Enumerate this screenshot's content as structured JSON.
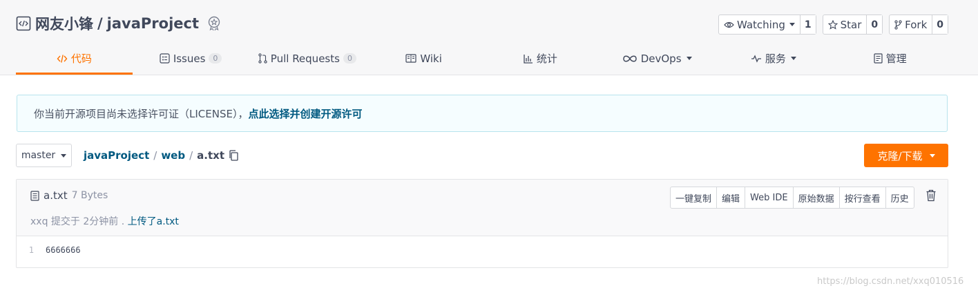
{
  "repo": {
    "owner": "网友小锋",
    "separator": "/",
    "name": "javaProject"
  },
  "actions": {
    "watch": {
      "label": "Watching",
      "count": "1"
    },
    "star": {
      "label": "Star",
      "count": "0"
    },
    "fork": {
      "label": "Fork",
      "count": "0"
    }
  },
  "tabs": [
    {
      "label": "代码",
      "active": true
    },
    {
      "label": "Issues",
      "count": "0"
    },
    {
      "label": "Pull Requests",
      "count": "0"
    },
    {
      "label": "Wiki"
    },
    {
      "label": "统计"
    },
    {
      "label": "DevOps"
    },
    {
      "label": "服务"
    },
    {
      "label": "管理"
    }
  ],
  "notice": {
    "text": "你当前开源项目尚未选择许可证（LICENSE），",
    "link": "点此选择并创建开源许可"
  },
  "branch": {
    "label": "master"
  },
  "breadcrumb": {
    "root": "javaProject",
    "sep1": "/",
    "dir": "web",
    "sep2": "/",
    "file": "a.txt"
  },
  "clone": {
    "label": "克隆/下载"
  },
  "file": {
    "name": "a.txt",
    "size": "7 Bytes",
    "commit_prefix": "xxq 提交于 2分钟前 .",
    "commit_message": "上传了a.txt",
    "tools": [
      "一键复制",
      "编辑",
      "Web IDE",
      "原始数据",
      "按行查看",
      "历史"
    ],
    "lines": [
      {
        "no": "1",
        "text": "6666666"
      }
    ]
  },
  "watermark": "https://blog.csdn.net/xxq010516",
  "colors": {
    "accent": "#fe7300",
    "link": "#005980",
    "notice_bg": "#f5fdff"
  }
}
